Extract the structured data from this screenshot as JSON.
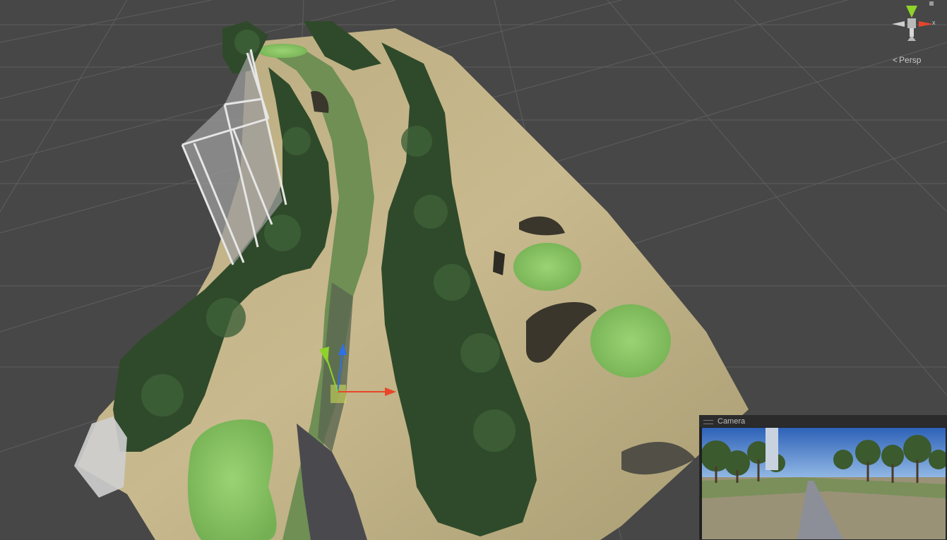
{
  "scene_view": {
    "projection_label": "Persp",
    "axis_label": "x"
  },
  "camera_preview": {
    "title": "Camera"
  },
  "colors": {
    "background": "#474747",
    "grid_line": "#5e5e5e",
    "fairway": "#6f8f55",
    "green": "#8ec86a",
    "sand": "#c9b98e",
    "tree": "#2f4a2a",
    "path": "#4a4a4e",
    "gizmo_x": "#e8452b",
    "gizmo_y": "#8fd32a",
    "gizmo_z": "#2f6fe8"
  }
}
